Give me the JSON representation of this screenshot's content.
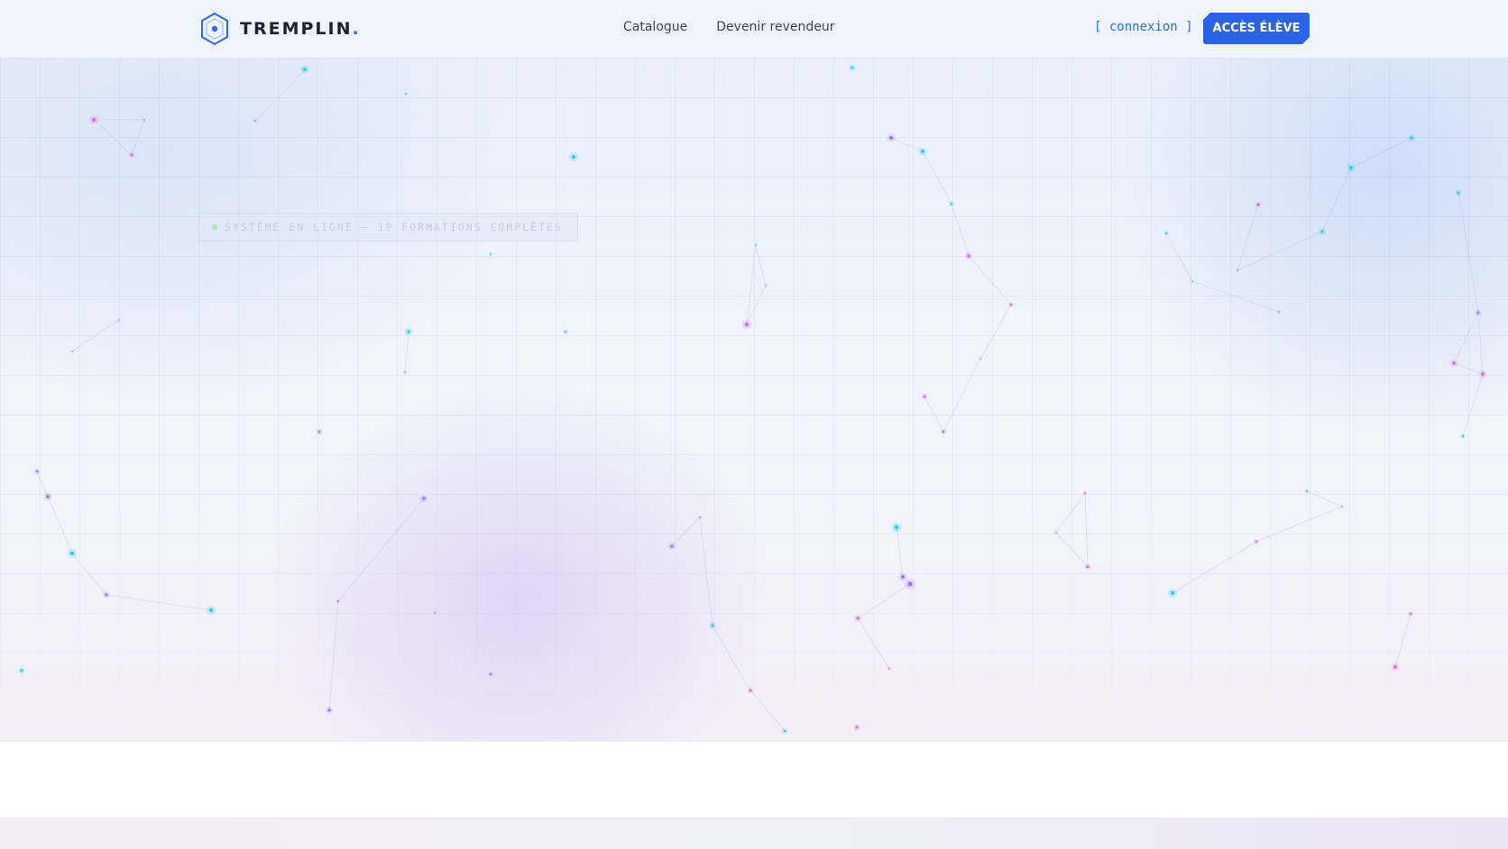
{
  "brand": {
    "name": "TREMPLIN",
    "dot": ".",
    "icon": "hexagon-logo-icon",
    "accent": "#2f6be5"
  },
  "nav": {
    "links": [
      {
        "label": "Catalogue"
      },
      {
        "label": "Devenir revendeur"
      }
    ],
    "login_label": "[ connexion ]",
    "cta_label": "ACCÈS ÉLÈVE"
  },
  "hero": {
    "status_badge": "SYSTÈME EN LIGNE — 19 FORMATIONS COMPLÈTES"
  },
  "colors": {
    "primary": "#2a63e6",
    "node_cyan": "#22c7ef",
    "node_magenta": "#e05ad8",
    "node_violet": "#9b6cf0",
    "status_online": "#a6e3c4"
  }
}
